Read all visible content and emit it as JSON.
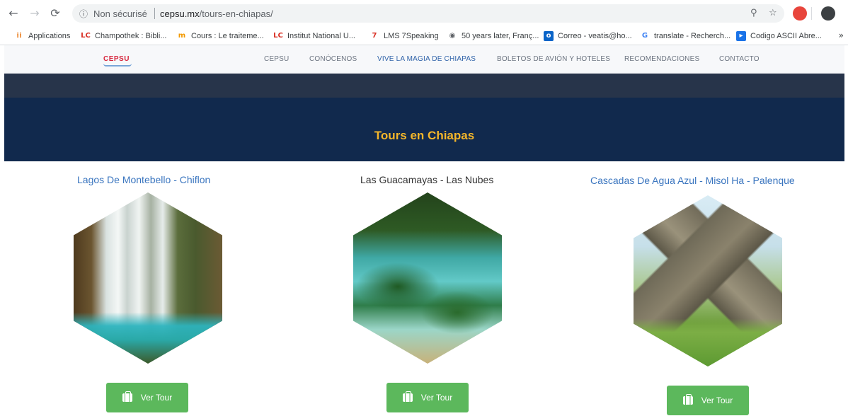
{
  "browser": {
    "insecure_label": "Non sécurisé",
    "url_domain": "cepsu.mx",
    "url_path": "/tours-en-chiapas/",
    "bookmarks": [
      {
        "label": "Applications",
        "icon": "apps-grid-icon",
        "color": "#e8710a"
      },
      {
        "label": "Champothek : Bibli...",
        "icon": "uc-logo-icon",
        "color": "#d93025"
      },
      {
        "label": "Cours : Le traiteme...",
        "icon": "moodle-icon",
        "color": "#f29900"
      },
      {
        "label": "Institut National U...",
        "icon": "uc-logo-icon",
        "color": "#d93025"
      },
      {
        "label": "LMS 7Speaking",
        "icon": "seven-icon",
        "color": "#d93025"
      },
      {
        "label": "50 years later, Franç...",
        "icon": "globe-icon",
        "color": "#5f6368"
      },
      {
        "label": "Correo - veatis@ho...",
        "icon": "outlook-icon",
        "color": "#0a64c8"
      },
      {
        "label": "translate - Recherch...",
        "icon": "google-icon",
        "color": "#4285f4"
      },
      {
        "label": "Codigo ASCII Abre...",
        "icon": "page-icon",
        "color": "#1a73e8"
      }
    ]
  },
  "site": {
    "logo": "CEPSU",
    "menu": [
      {
        "label": "CEPSU",
        "active": false
      },
      {
        "label": "CONÓCENOS",
        "active": false
      },
      {
        "label": "VIVE LA MAGIA DE CHIAPAS",
        "active": true
      },
      {
        "label": "BOLETOS DE AVIÓN Y HOTELES",
        "active": false
      },
      {
        "label": "RECOMENDACIONES",
        "active": false
      },
      {
        "label": "CONTACTO",
        "active": false
      }
    ],
    "hero_title": "Tours en Chiapas",
    "tours": [
      {
        "title": "Lagos De Montebello - Chiflon",
        "button": "Ver Tour",
        "image": "waterfall"
      },
      {
        "title": "Las Guacamayas - Las Nubes",
        "button": "Ver Tour",
        "image": "lakes"
      },
      {
        "title": "Cascadas De Agua Azul - Misol Ha - Palenque",
        "button": "Ver Tour",
        "image": "pyramid"
      }
    ]
  },
  "colors": {
    "hero_bg": "#11294d",
    "hero_title": "#f4b62a",
    "link": "#3a75bf",
    "button": "#5cb85c"
  }
}
